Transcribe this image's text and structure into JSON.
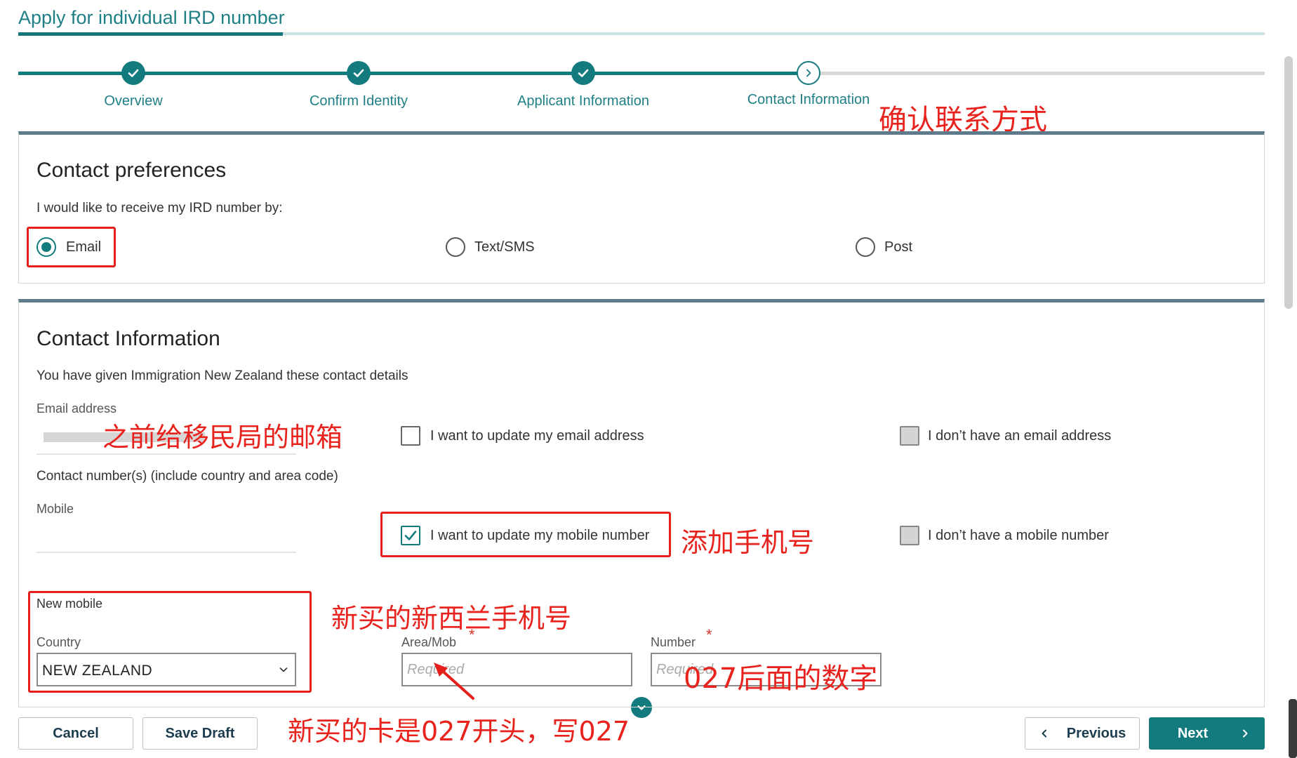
{
  "page": {
    "title": "Apply for individual IRD number"
  },
  "stepper": {
    "steps": [
      {
        "label": "Overview",
        "state": "done"
      },
      {
        "label": "Confirm Identity",
        "state": "done"
      },
      {
        "label": "Applicant Information",
        "state": "done"
      },
      {
        "label": "Contact Information",
        "state": "current"
      }
    ]
  },
  "contact_preferences": {
    "title": "Contact preferences",
    "prompt": "I would like to receive my IRD number by:",
    "options": [
      {
        "label": "Email",
        "selected": true
      },
      {
        "label": "Text/SMS",
        "selected": false
      },
      {
        "label": "Post",
        "selected": false
      }
    ]
  },
  "contact_information": {
    "title": "Contact Information",
    "intro": "You have given Immigration New Zealand these contact details",
    "email": {
      "label": "Email address",
      "update_label": "I want to update my email address",
      "update_checked": false,
      "none_label": "I don’t have an email address",
      "none_checked": false
    },
    "contact_numbers_label": "Contact number(s) (include country and area code)",
    "mobile": {
      "label": "Mobile",
      "update_label": "I want to update my mobile number",
      "update_checked": true,
      "none_label": "I don’t have a mobile number",
      "none_checked": false
    },
    "new_mobile": {
      "label": "New mobile",
      "country_label": "Country",
      "country_value": "NEW ZEALAND",
      "area_label": "Area/Mob",
      "area_placeholder": "Required",
      "number_label": "Number",
      "number_placeholder": "Required",
      "required_mark": "*"
    }
  },
  "footer": {
    "cancel": "Cancel",
    "save_draft": "Save Draft",
    "previous": "Previous",
    "next": "Next"
  },
  "annotations": {
    "confirm_contact": "确认联系方式",
    "previous_email": "之前给移民局的邮箱",
    "add_mobile": "添加手机号",
    "new_nz_mobile": "新买的新西兰手机号",
    "number_after_027": "027后面的数字",
    "starts_with_027": "新买的卡是027开头，写027"
  },
  "colors": {
    "accent": "#137a7e",
    "annotation": "#e5201c",
    "panel_border_top": "#5f7a8a"
  }
}
